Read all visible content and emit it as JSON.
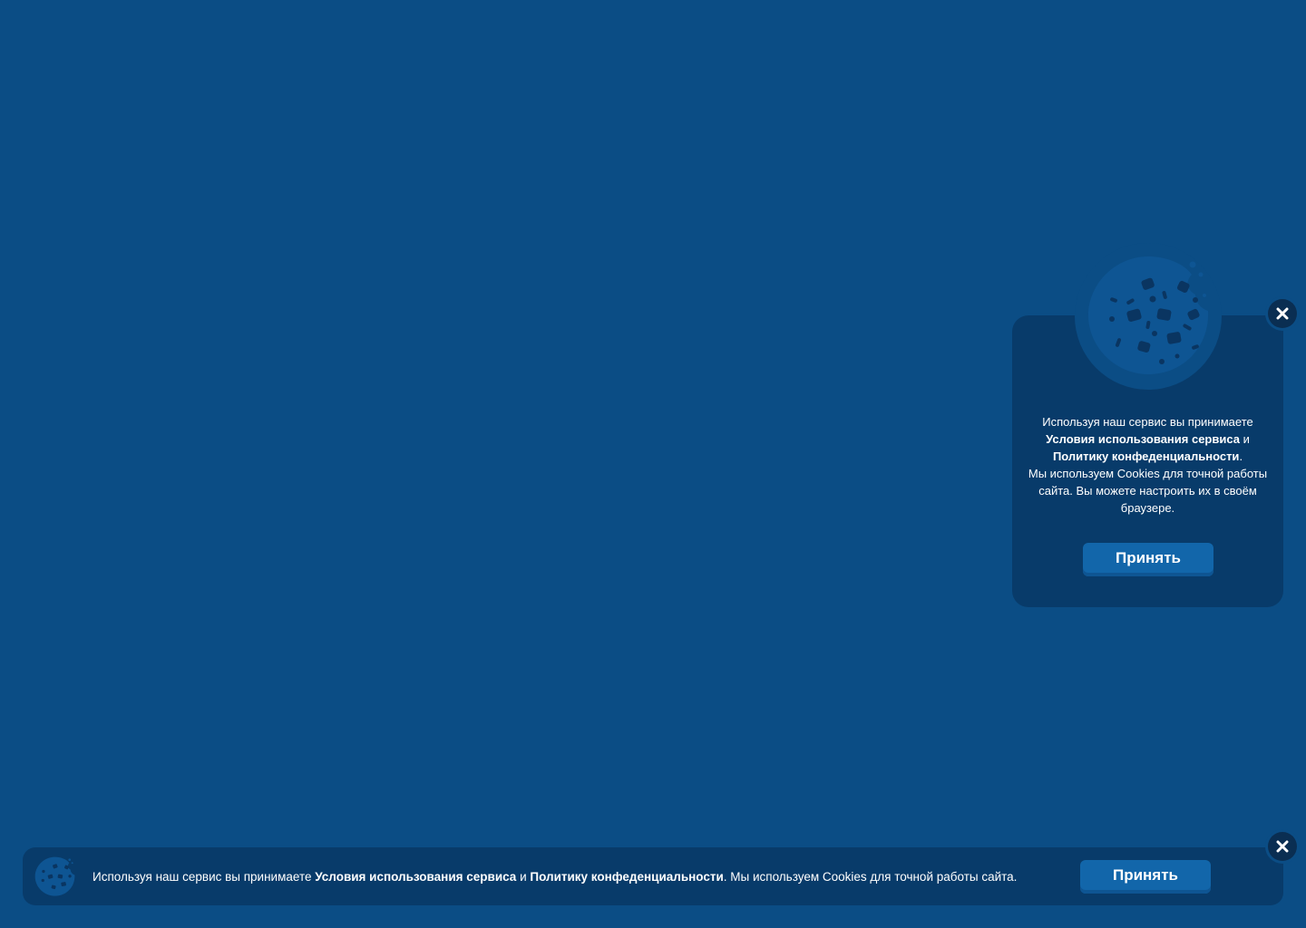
{
  "colors": {
    "page_background": "#0b4d85",
    "card_background": "#083b6a",
    "button_background": "#1266aa",
    "close_background": "#0a2e52",
    "cookie_fill": "#0e5593",
    "cookie_chips": "#0a3561",
    "text": "#ffffff"
  },
  "popup": {
    "icon": "cookie-icon",
    "text_intro": "Используя наш сервис вы принимаете",
    "terms_link": "Условия использования сервиса",
    "conj": "и",
    "privacy_link": "Политику конфеденциальности",
    "period": ".",
    "text_cookies": "Мы используем Cookies для точной работы сайта. Вы можете настроить их в своём браузере.",
    "accept_label": "Принять",
    "close_icon": "close-icon"
  },
  "bar": {
    "icon": "cookie-icon",
    "text_intro": "Используя наш сервис вы принимаете",
    "terms_link": "Условия использования сервиса",
    "conj": "и",
    "privacy_link": "Политику конфеденциальности",
    "text_cookies": ". Мы используем Cookies для точной работы сайта.",
    "accept_label": "Принять",
    "close_icon": "close-icon"
  }
}
